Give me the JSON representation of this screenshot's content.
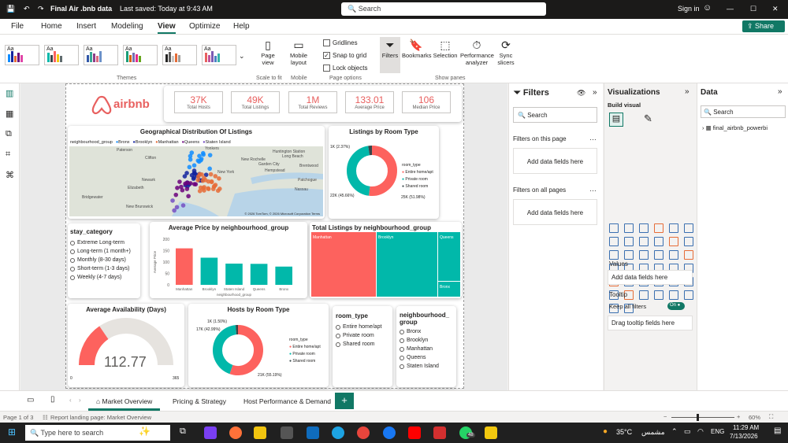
{
  "titlebar": {
    "title": "Final Air .bnb data",
    "saved": "Last saved: Today at 9:43 AM",
    "search": "Search",
    "signin": "Sign in"
  },
  "menu": {
    "items": [
      "File",
      "Home",
      "Insert",
      "Modeling",
      "View",
      "Optimize",
      "Help"
    ],
    "share": "Share"
  },
  "ribbon": {
    "themes_label": "Themes",
    "theme_aa": "Aa",
    "page_view": "Page view",
    "scale_to_fit": "Scale to fit",
    "mobile_layout": "Mobile layout",
    "mobile": "Mobile",
    "gridlines": "Gridlines",
    "snap": "Snap to grid",
    "lock": "Lock objects",
    "page_options": "Page options",
    "filters": "Filters",
    "bookmarks": "Bookmarks",
    "selection": "Selection",
    "performance": "Performance analyzer",
    "sync": "Sync slicers",
    "show_panes": "Show panes"
  },
  "report": {
    "logo": "airbnb",
    "kpis": [
      {
        "value": "37K",
        "label": "Total Hosts"
      },
      {
        "value": "49K",
        "label": "Total Listings"
      },
      {
        "value": "1M",
        "label": "Total Reviews"
      },
      {
        "value": "133.01",
        "label": "Average Price"
      },
      {
        "value": "106",
        "label": "Median Price"
      }
    ],
    "map": {
      "title": "Geographical Distribution Of Listings",
      "legend_label": "neighbourhood_group",
      "legend": [
        "Bronx",
        "Brooklyn",
        "Manhattan",
        "Queens",
        "Staten Island"
      ],
      "places": [
        "Paterson",
        "Yonkers",
        "New Rochelle",
        "Clifton",
        "Newark",
        "Elizabeth",
        "New York",
        "Bridgewater",
        "Long Beach",
        "New Brunswick",
        "Hempstead",
        "Garden City",
        "Brentwood",
        "Patchogue",
        "Huntington Station",
        "Nassau"
      ],
      "attrib": "© 2026 TomTom, © 2026 Microsoft Corporation  Terms"
    },
    "room_donut": {
      "title": "Listings by Room Type",
      "legend_title": "room_type",
      "legend": [
        "Entire home/apt",
        "Private room",
        "Shared room"
      ],
      "labels": [
        "1K (2.37%)",
        "22K (45.66%)",
        "25K (51.98%)"
      ]
    },
    "stay": {
      "title": "stay_category",
      "items": [
        "Extreme Long-term",
        "Long-term (1 month+)",
        "Monthly (8-30 days)",
        "Short-term (1-3 days)",
        "Weekly (4-7 days)"
      ]
    },
    "avg_price": {
      "title": "Average Price by neighbourhood_group",
      "ylabel": "Average Price",
      "xlabel": "neighbourhood_group",
      "yticks": [
        "200",
        "150",
        "100",
        "50",
        "0"
      ]
    },
    "treemap": {
      "title": "Total Listings by neighbourhood_group",
      "cells": [
        "Manhattan",
        "Brooklyn",
        "Queens",
        "Bronx"
      ]
    },
    "avail": {
      "title": "Average Availability (Days)",
      "value": "112.77",
      "min": "0",
      "max": "365"
    },
    "hosts_donut": {
      "title": "Hosts by Room Type",
      "legend_title": "room_type",
      "legend": [
        "Entire home/apt",
        "Private room",
        "Shared room"
      ],
      "labels": [
        "1K (1.50%)",
        "17K (42.99%)",
        "21K (55.19%)"
      ]
    },
    "room_slicer": {
      "title": "room_type",
      "items": [
        "Entire home/apt",
        "Private room",
        "Shared room"
      ]
    },
    "nbhd_slicer": {
      "title": "neighbourhood_ group",
      "items": [
        "Bronx",
        "Brooklyn",
        "Manhattan",
        "Queens",
        "Staten Island"
      ]
    }
  },
  "chart_data": [
    {
      "type": "bar",
      "title": "Average Price by neighbourhood_group",
      "categories": [
        "Manhattan",
        "Brooklyn",
        "Staten Island",
        "Queens",
        "Bronx"
      ],
      "values": [
        160,
        119,
        93,
        92,
        80
      ],
      "xlabel": "neighbourhood_group",
      "ylabel": "Average Price",
      "ylim": [
        0,
        200
      ]
    },
    {
      "type": "pie",
      "title": "Listings by Room Type",
      "categories": [
        "Entire home/apt",
        "Private room",
        "Shared room"
      ],
      "values": [
        51.98,
        45.66,
        2.37
      ]
    },
    {
      "type": "pie",
      "title": "Hosts by Room Type",
      "categories": [
        "Entire home/apt",
        "Private room",
        "Shared room"
      ],
      "values": [
        55.19,
        42.99,
        1.5
      ]
    }
  ],
  "filters": {
    "title": "Filters",
    "search": "Search",
    "on_page": "Filters on this page",
    "add1": "Add data fields here",
    "on_all": "Filters on all pages",
    "add2": "Add data fields here"
  },
  "viz": {
    "title": "Visualizations",
    "build": "Build visual",
    "values": "Values",
    "add_values": "Add data fields here",
    "tooltip": "Tooltip",
    "keep": "Keep all filters",
    "on": "On",
    "drag": "Drag tooltip fields here"
  },
  "data": {
    "title": "Data",
    "search": "Search",
    "table": "final_airbnb_powerbi"
  },
  "tabs": [
    "Market Overview",
    "Pricing & Strategy",
    "Host Performance & Demand"
  ],
  "status": {
    "page": "Page 1 of 3",
    "landing": "Report landing page: Market Overview",
    "zoom": "60%"
  },
  "taskbar": {
    "search": "Type here to search",
    "temp": "35°C",
    "weather": "مشمس",
    "lang": "ENG",
    "time": "11:29 AM",
    "date": "7/13/2026",
    "badge": "48"
  },
  "colors": {
    "accent": "#117865",
    "red": "#fd625e",
    "teal": "#01b8aa",
    "dark": "#374649",
    "purple": "#5d2e8c"
  }
}
